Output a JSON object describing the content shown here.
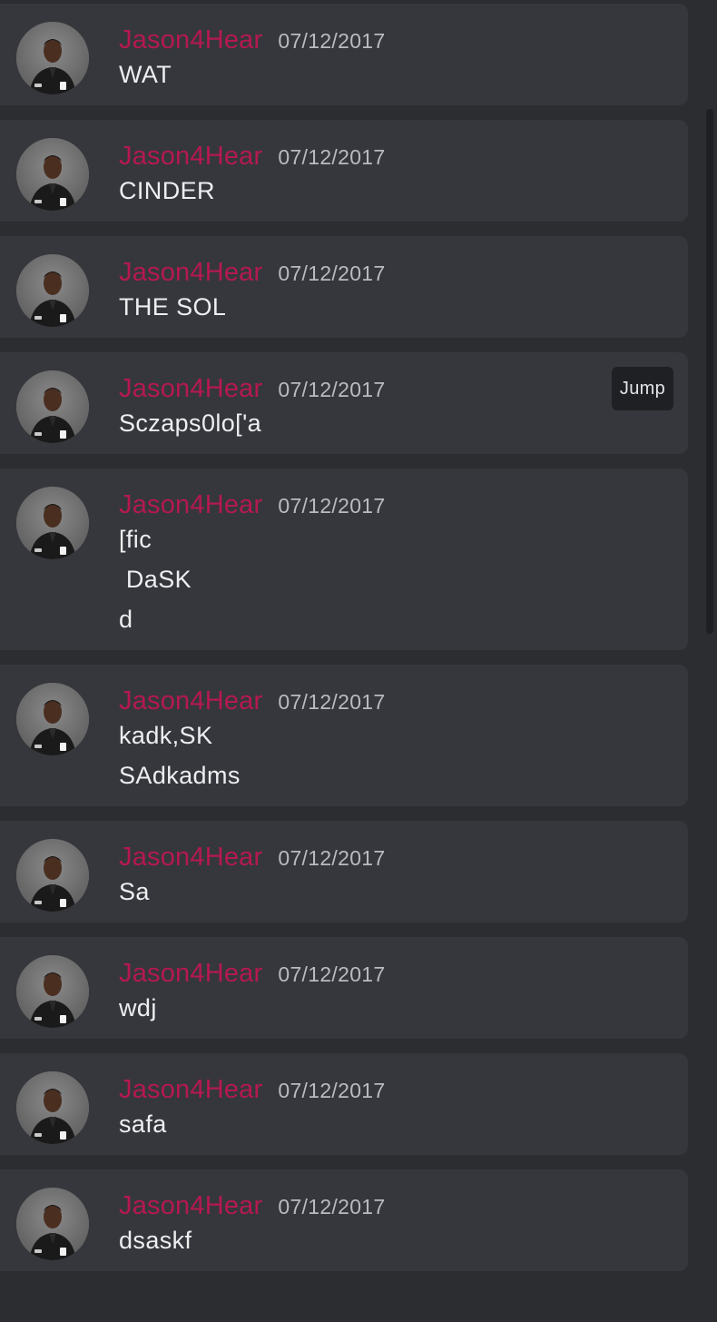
{
  "messages": [
    {
      "author": "Jason4Hear",
      "timestamp": "07/12/2017",
      "lines": [
        "WAT"
      ]
    },
    {
      "author": "Jason4Hear",
      "timestamp": "07/12/2017",
      "lines": [
        "CINDER"
      ]
    },
    {
      "author": "Jason4Hear",
      "timestamp": "07/12/2017",
      "lines": [
        "THE SOL"
      ]
    },
    {
      "author": "Jason4Hear",
      "timestamp": "07/12/2017",
      "lines": [
        "Sczaps0lo['a"
      ],
      "jump_label": "Jump"
    },
    {
      "author": "Jason4Hear",
      "timestamp": "07/12/2017",
      "lines": [
        "[fic",
        " DaSK",
        "d"
      ]
    },
    {
      "author": "Jason4Hear",
      "timestamp": "07/12/2017",
      "lines": [
        "kadk,SK",
        "SAdkadms"
      ]
    },
    {
      "author": "Jason4Hear",
      "timestamp": "07/12/2017",
      "lines": [
        "Sa"
      ]
    },
    {
      "author": "Jason4Hear",
      "timestamp": "07/12/2017",
      "lines": [
        "wdj"
      ]
    },
    {
      "author": "Jason4Hear",
      "timestamp": "07/12/2017",
      "lines": [
        "safa"
      ]
    },
    {
      "author": "Jason4Hear",
      "timestamp": "07/12/2017",
      "lines": [
        "dsaskf"
      ]
    }
  ],
  "colors": {
    "background": "#2b2d31",
    "card": "#35373c",
    "author": "#b5194f",
    "timestamp": "#b9bbbe",
    "text": "#eceef0"
  },
  "icons": {
    "avatar": "avatar-image"
  }
}
